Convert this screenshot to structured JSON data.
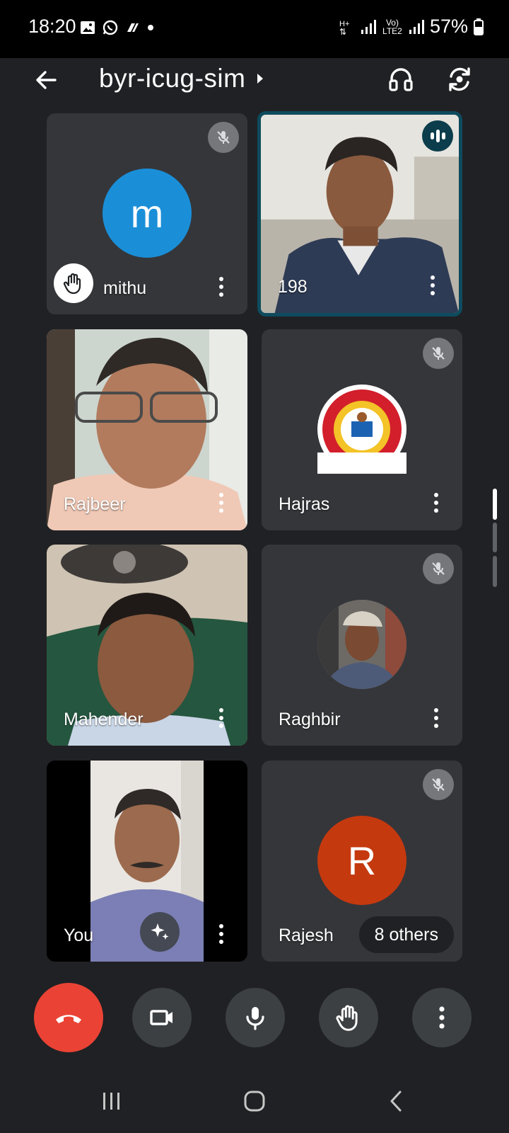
{
  "status_bar": {
    "time": "18:20",
    "icons": [
      "gallery-icon",
      "whatsapp-icon",
      "drive-icon",
      "dot-icon"
    ],
    "network_label": "Vo) LTE2",
    "battery": "57%"
  },
  "header": {
    "meeting_code": "byr-icug-sim",
    "icons": [
      "back-arrow-icon",
      "chevron-right-icon",
      "headset-icon",
      "switch-camera-icon"
    ]
  },
  "participants": [
    {
      "name": "mithu",
      "initial": "m",
      "avatar_color": "#1a8fd8",
      "muted": true,
      "hand_raised": true,
      "speaking": false,
      "type": "initial"
    },
    {
      "name": "198",
      "muted": false,
      "speaking": true,
      "type": "video"
    },
    {
      "name": "Rajbeer",
      "muted": false,
      "speaking": false,
      "type": "video"
    },
    {
      "name": "Hajras",
      "muted": true,
      "speaking": false,
      "type": "photo-avatar"
    },
    {
      "name": "Mahender",
      "muted": false,
      "speaking": false,
      "type": "video"
    },
    {
      "name": "Raghbir",
      "muted": true,
      "speaking": false,
      "type": "photo-avatar"
    },
    {
      "name": "You",
      "muted": false,
      "speaking": false,
      "type": "video",
      "effects": true
    },
    {
      "name": "Rajesh",
      "initial": "R",
      "avatar_color": "#c5390f",
      "muted": true,
      "speaking": false,
      "type": "initial",
      "others_label": "8 others"
    }
  ],
  "controls": {
    "icons": [
      "end-call-icon",
      "camera-icon",
      "microphone-icon",
      "raise-hand-icon",
      "more-options-icon"
    ],
    "end_color": "#ea4335"
  },
  "nav": {
    "icons": [
      "recents-icon",
      "home-icon",
      "back-icon"
    ]
  }
}
